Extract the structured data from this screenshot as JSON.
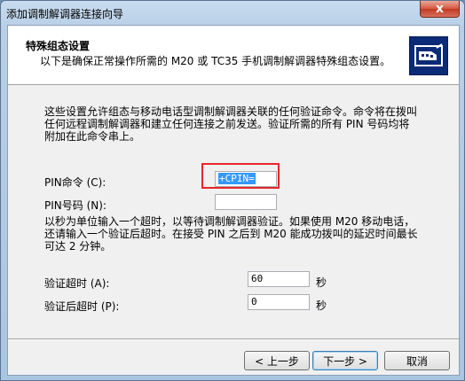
{
  "window": {
    "title": "添加调制解调器连接向导",
    "close_glyph": "x"
  },
  "header": {
    "title": "特殊组态设置",
    "subtitle": "以下是确保正常操作所需的 M20 或 TC35 手机调制解调器特殊组态设置。",
    "icon": "modem-phone-icon"
  },
  "description": [
    "这些设置允许组态与移动电话型调制解调器关联的任何验证命令。命令将在拨叫",
    "任何远程调制解调器和建立任何连接之前发送。验证所需的所有 PIN 号码均将",
    "附加在此命令串上。"
  ],
  "pin_command": {
    "label": "PIN命令 (C):",
    "value": "+CPIN="
  },
  "pin_number": {
    "label": "PIN号码 (N):",
    "value": ""
  },
  "timeout_note": [
    "以秒为单位输入一个超时，以等待调制解调器验证。如果使用 M20 移动电话，",
    "还请输入一个验证后超时。在接受 PIN 之后到 M20 能成功拨叫的延迟时间最长",
    "可达 2 分钟。"
  ],
  "verify_timeout": {
    "label": "验证超时 (A):",
    "value": "60",
    "unit": "秒"
  },
  "post_verify_timeout": {
    "label": "验证后超时 (P):",
    "value": "0",
    "unit": "秒"
  },
  "buttons": {
    "back": "< 上一步",
    "next": "下一步 >",
    "cancel": "取消"
  },
  "colors": {
    "highlight": "#e8262a",
    "selection": "#3399ff",
    "icon_bg": "#0b2a77"
  }
}
